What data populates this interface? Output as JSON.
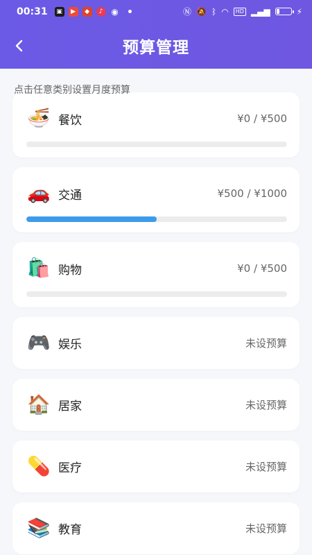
{
  "status": {
    "time": "00:31",
    "hd": "HD"
  },
  "header": {
    "title": "预算管理"
  },
  "hint": "点击任意类别设置月度预算",
  "categories": [
    {
      "name": "餐饮",
      "icon": "noodles-icon",
      "glyph": "🍜",
      "amount": "¥0 / ¥500",
      "progress": 0,
      "has_bar": true
    },
    {
      "name": "交通",
      "icon": "car-icon",
      "glyph": "🚗",
      "amount": "¥500 / ¥1000",
      "progress": 50,
      "has_bar": true
    },
    {
      "name": "购物",
      "icon": "shopping-bags-icon",
      "glyph": "🛍️",
      "amount": "¥0 / ¥500",
      "progress": 0,
      "has_bar": true
    },
    {
      "name": "娱乐",
      "icon": "game-controller-icon",
      "glyph": "🎮",
      "amount": "未设预算",
      "has_bar": false
    },
    {
      "name": "居家",
      "icon": "house-icon",
      "glyph": "🏠",
      "amount": "未设预算",
      "has_bar": false
    },
    {
      "name": "医疗",
      "icon": "pill-icon",
      "glyph": "💊",
      "amount": "未设预算",
      "has_bar": false
    },
    {
      "name": "教育",
      "icon": "books-icon",
      "glyph": "📚",
      "amount": "未设预算",
      "has_bar": false
    }
  ],
  "colors": {
    "accent": "#6b5ae6",
    "progress": "#3e9be9",
    "track": "#ececec"
  }
}
